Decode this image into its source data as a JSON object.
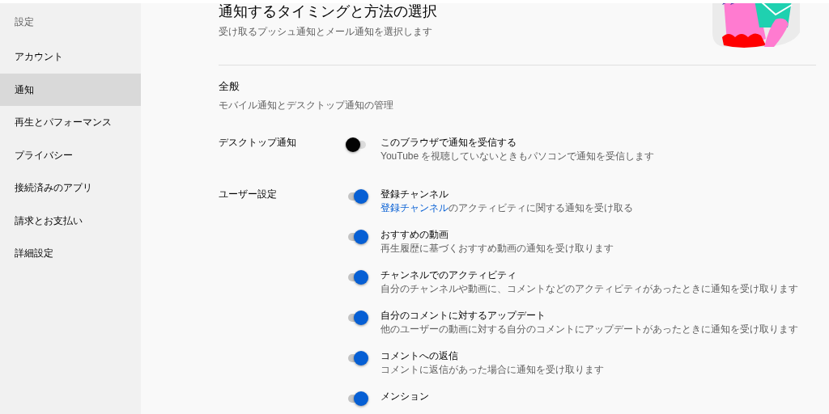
{
  "sidebar": {
    "heading": "設定",
    "items": [
      {
        "label": "アカウント",
        "selected": false
      },
      {
        "label": "通知",
        "selected": true
      },
      {
        "label": "再生とパフォーマンス",
        "selected": false
      },
      {
        "label": "プライバシー",
        "selected": false
      },
      {
        "label": "接続済みのアプリ",
        "selected": false
      },
      {
        "label": "請求とお支払い",
        "selected": false
      },
      {
        "label": "詳細設定",
        "selected": false
      }
    ]
  },
  "header": {
    "title": "通知するタイミングと方法の選択",
    "subtitle": "受け取るプッシュ通知とメール通知を選択します"
  },
  "general": {
    "title": "全般",
    "description": "モバイル通知とデスクトップ通知の管理"
  },
  "groups": [
    {
      "label": "デスクトップ通知",
      "rows": [
        {
          "title": "このブラウザで通知を受信する",
          "description": "YouTube を視聴していないときもパソコンで通知を受信します",
          "on": false
        }
      ]
    },
    {
      "label": "ユーザー設定",
      "rows": [
        {
          "title": "登録チャンネル",
          "link": "登録チャンネル",
          "description": "のアクティビティに関する通知を受け取る",
          "on": true
        },
        {
          "title": "おすすめの動画",
          "description": "再生履歴に基づくおすすめ動画の通知を受け取ります",
          "on": true
        },
        {
          "title": "チャンネルでのアクティビティ",
          "description": "自分のチャンネルや動画に、コメントなどのアクティビティがあったときに通知を受け取ります",
          "on": true
        },
        {
          "title": "自分のコメントに対するアップデート",
          "description": "他のユーザーの動画に対する自分のコメントにアップデートがあったときに通知を受け取ります",
          "on": true
        },
        {
          "title": "コメントへの返信",
          "description": "コメントに返信があった場合に通知を受け取ります",
          "on": true
        },
        {
          "title": "メンション",
          "on": true
        }
      ]
    }
  ]
}
